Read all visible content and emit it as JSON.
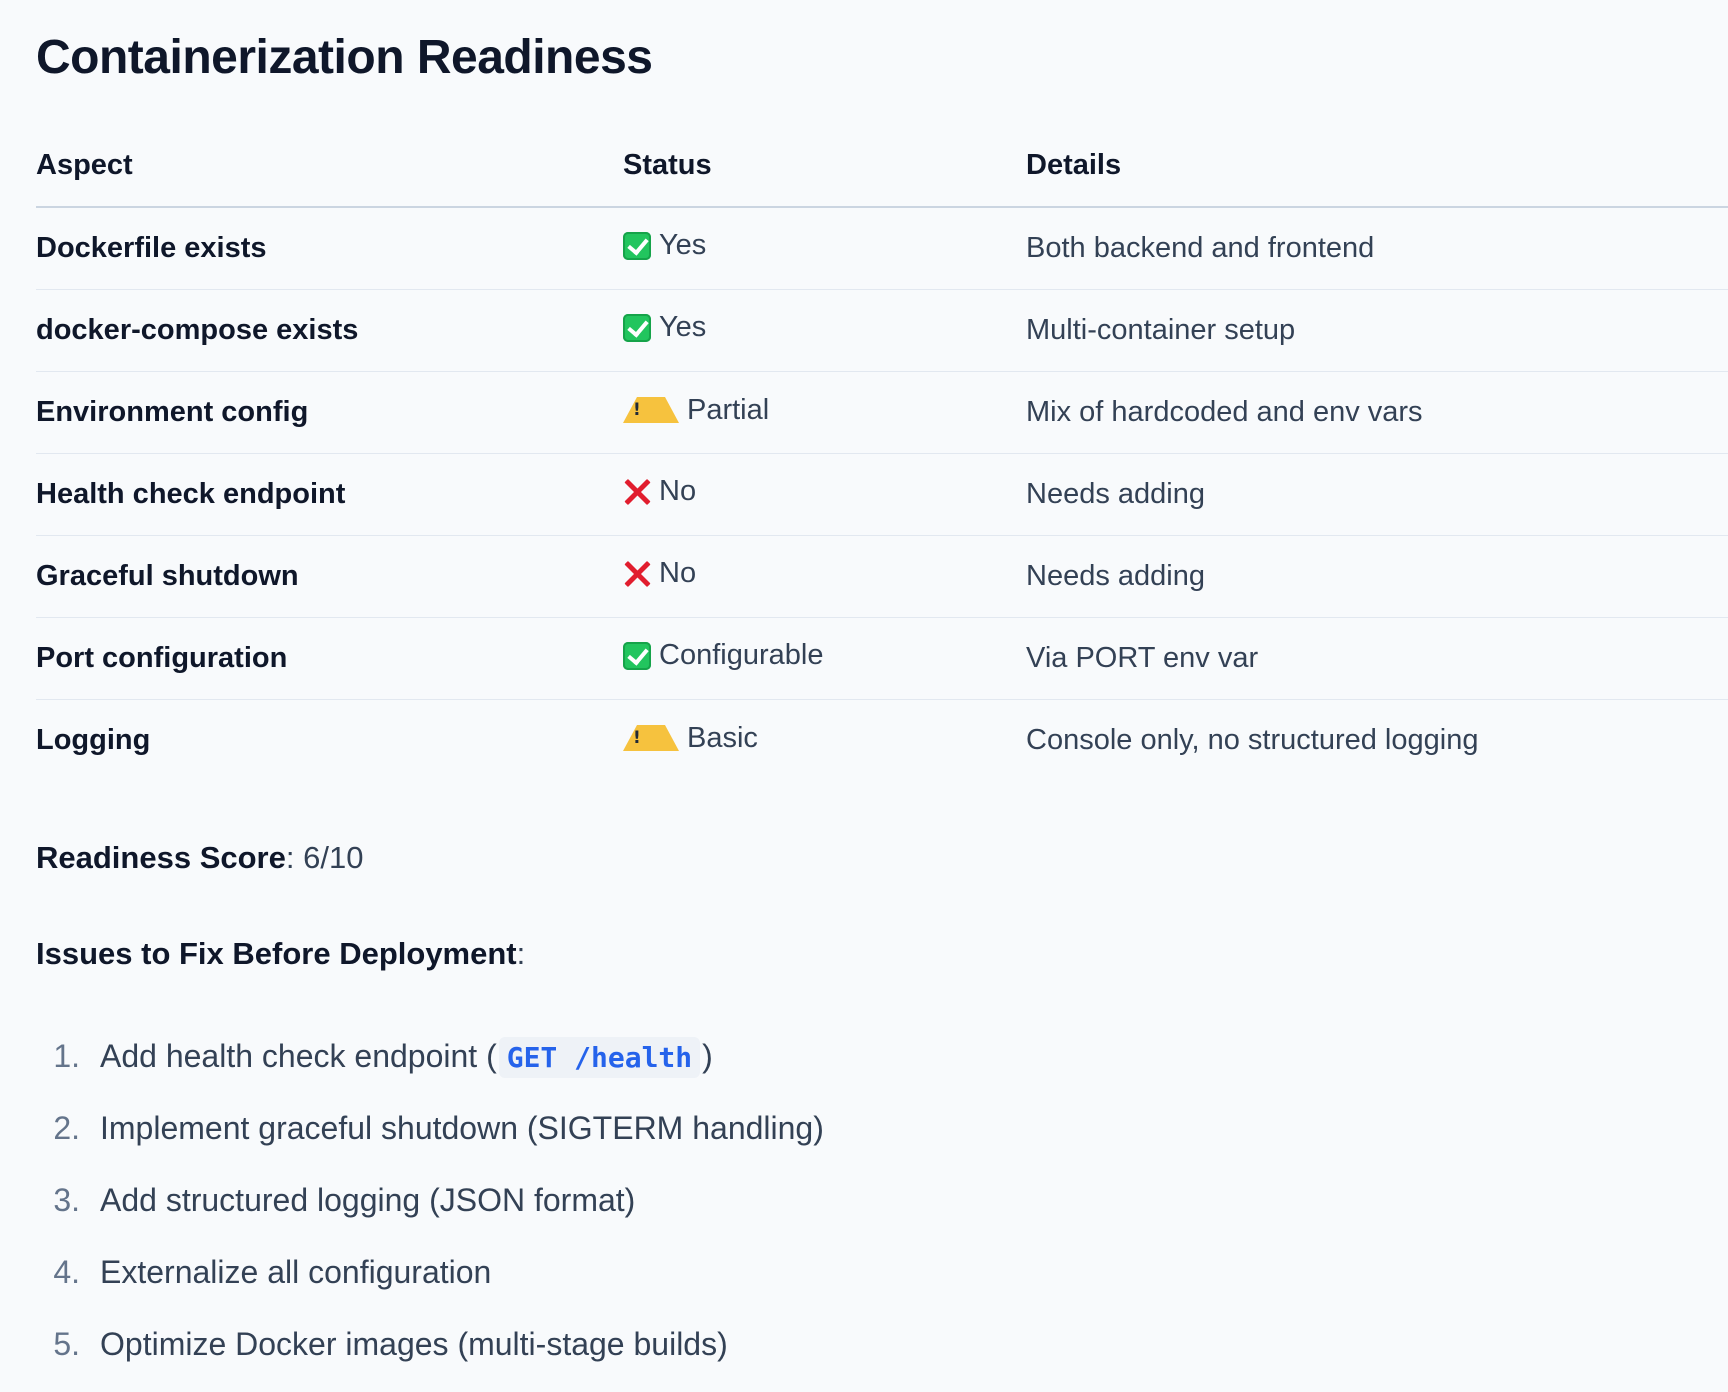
{
  "title": "Containerization Readiness",
  "table": {
    "headers": [
      "Aspect",
      "Status",
      "Details"
    ],
    "rows": [
      {
        "aspect": "Dockerfile exists",
        "status_icon": "check-icon",
        "status": "Yes",
        "details": "Both backend and frontend"
      },
      {
        "aspect": "docker-compose exists",
        "status_icon": "check-icon",
        "status": "Yes",
        "details": "Multi-container setup"
      },
      {
        "aspect": "Environment config",
        "status_icon": "warning-icon",
        "status": "Partial",
        "details": "Mix of hardcoded and env vars"
      },
      {
        "aspect": "Health check endpoint",
        "status_icon": "cross-icon",
        "status": "No",
        "details": "Needs adding"
      },
      {
        "aspect": "Graceful shutdown",
        "status_icon": "cross-icon",
        "status": "No",
        "details": "Needs adding"
      },
      {
        "aspect": "Port configuration",
        "status_icon": "check-icon",
        "status": "Configurable",
        "details": "Via PORT env var"
      },
      {
        "aspect": "Logging",
        "status_icon": "warning-icon",
        "status": "Basic",
        "details": "Console only, no structured logging"
      }
    ]
  },
  "score": {
    "label": "Readiness Score",
    "value": "6/10"
  },
  "issues": {
    "title": "Issues to Fix Before Deployment",
    "items": [
      {
        "number": "1.",
        "text_before": "Add health check endpoint (",
        "code": "GET /health",
        "text_after": ")"
      },
      {
        "number": "2.",
        "text_before": "Implement graceful shutdown (SIGTERM handling)",
        "code": "",
        "text_after": ""
      },
      {
        "number": "3.",
        "text_before": "Add structured logging (JSON format)",
        "code": "",
        "text_after": ""
      },
      {
        "number": "4.",
        "text_before": "Externalize all configuration",
        "code": "",
        "text_after": ""
      },
      {
        "number": "5.",
        "text_before": "Optimize Docker images (multi-stage builds)",
        "code": "",
        "text_after": ""
      }
    ]
  },
  "colors": {
    "background": "#f8fafc",
    "heading": "#0f172a",
    "body_text": "#334155",
    "check": "#22c55e",
    "warning": "#f6c23e",
    "cross": "#e11d2e",
    "code": "#2563eb"
  }
}
